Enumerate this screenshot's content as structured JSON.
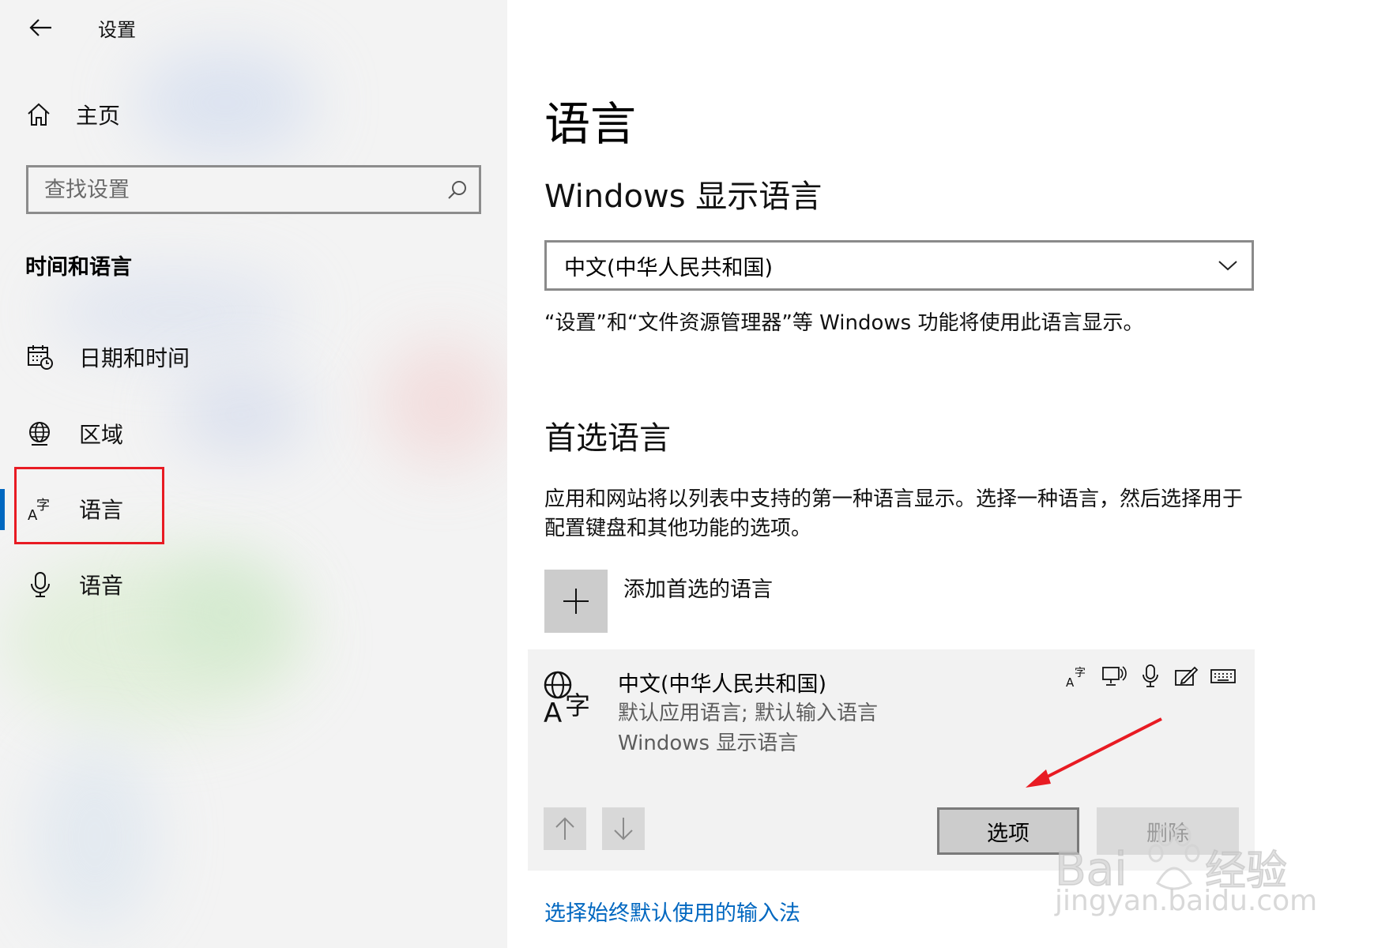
{
  "window": {
    "title": "设置"
  },
  "sidebar": {
    "home_label": "主页",
    "search_placeholder": "查找设置",
    "section_title": "时间和语言",
    "items": [
      {
        "label": "日期和时间",
        "icon": "calendar-clock-icon"
      },
      {
        "label": "区域",
        "icon": "globe-region-icon"
      },
      {
        "label": "语言",
        "icon": "language-icon",
        "selected": true
      },
      {
        "label": "语音",
        "icon": "microphone-icon"
      }
    ]
  },
  "main": {
    "page_title": "语言",
    "display_language_title": "Windows 显示语言",
    "display_language_value": "中文(中华人民共和国)",
    "display_language_desc": "“设置”和“文件资源管理器”等 Windows 功能将使用此语言显示。",
    "preferred_title": "首选语言",
    "preferred_desc": "应用和网站将以列表中支持的第一种语言显示。选择一种语言，然后选择用于配置键盘和其他功能的选项。",
    "add_language_label": "添加首选的语言",
    "language_entry": {
      "name": "中文(中华人民共和国)",
      "line1": "默认应用语言; 默认输入语言",
      "line2": "Windows 显示语言",
      "features": [
        "language-pack-icon",
        "text-to-speech-icon",
        "speech-recognition-icon",
        "handwriting-icon",
        "keyboard-icon"
      ]
    },
    "options_label": "选项",
    "remove_label": "删除",
    "input_method_link": "选择始终默认使用的输入法"
  },
  "colors": {
    "accent": "#0067c0",
    "highlight_box": "#e81b23",
    "annotation_arrow": "#e81b23"
  },
  "watermark": {
    "brand": "Bai 经验",
    "url": "jingyan.baidu.com"
  }
}
